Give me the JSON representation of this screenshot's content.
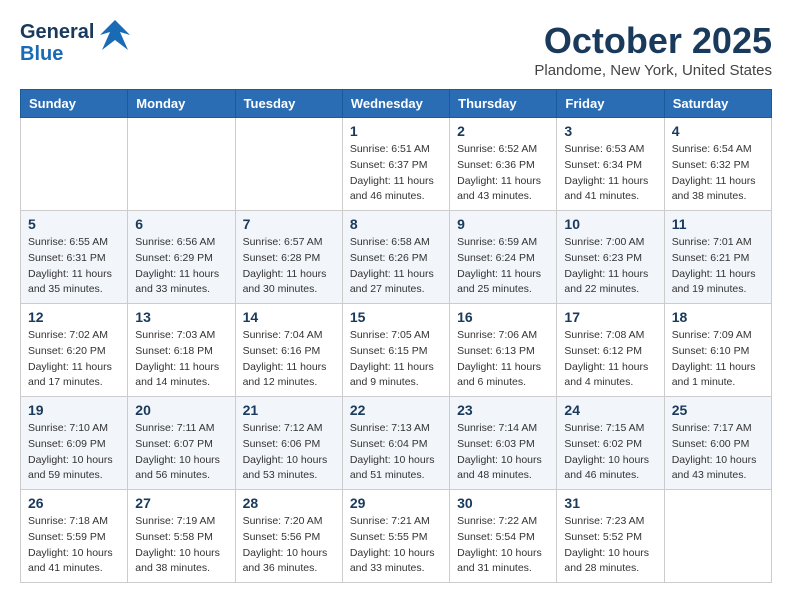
{
  "header": {
    "logo_line1": "General",
    "logo_line2": "Blue",
    "month": "October 2025",
    "location": "Plandome, New York, United States"
  },
  "days_of_week": [
    "Sunday",
    "Monday",
    "Tuesday",
    "Wednesday",
    "Thursday",
    "Friday",
    "Saturday"
  ],
  "weeks": [
    [
      {
        "day": "",
        "info": ""
      },
      {
        "day": "",
        "info": ""
      },
      {
        "day": "",
        "info": ""
      },
      {
        "day": "1",
        "info": "Sunrise: 6:51 AM\nSunset: 6:37 PM\nDaylight: 11 hours\nand 46 minutes."
      },
      {
        "day": "2",
        "info": "Sunrise: 6:52 AM\nSunset: 6:36 PM\nDaylight: 11 hours\nand 43 minutes."
      },
      {
        "day": "3",
        "info": "Sunrise: 6:53 AM\nSunset: 6:34 PM\nDaylight: 11 hours\nand 41 minutes."
      },
      {
        "day": "4",
        "info": "Sunrise: 6:54 AM\nSunset: 6:32 PM\nDaylight: 11 hours\nand 38 minutes."
      }
    ],
    [
      {
        "day": "5",
        "info": "Sunrise: 6:55 AM\nSunset: 6:31 PM\nDaylight: 11 hours\nand 35 minutes."
      },
      {
        "day": "6",
        "info": "Sunrise: 6:56 AM\nSunset: 6:29 PM\nDaylight: 11 hours\nand 33 minutes."
      },
      {
        "day": "7",
        "info": "Sunrise: 6:57 AM\nSunset: 6:28 PM\nDaylight: 11 hours\nand 30 minutes."
      },
      {
        "day": "8",
        "info": "Sunrise: 6:58 AM\nSunset: 6:26 PM\nDaylight: 11 hours\nand 27 minutes."
      },
      {
        "day": "9",
        "info": "Sunrise: 6:59 AM\nSunset: 6:24 PM\nDaylight: 11 hours\nand 25 minutes."
      },
      {
        "day": "10",
        "info": "Sunrise: 7:00 AM\nSunset: 6:23 PM\nDaylight: 11 hours\nand 22 minutes."
      },
      {
        "day": "11",
        "info": "Sunrise: 7:01 AM\nSunset: 6:21 PM\nDaylight: 11 hours\nand 19 minutes."
      }
    ],
    [
      {
        "day": "12",
        "info": "Sunrise: 7:02 AM\nSunset: 6:20 PM\nDaylight: 11 hours\nand 17 minutes."
      },
      {
        "day": "13",
        "info": "Sunrise: 7:03 AM\nSunset: 6:18 PM\nDaylight: 11 hours\nand 14 minutes."
      },
      {
        "day": "14",
        "info": "Sunrise: 7:04 AM\nSunset: 6:16 PM\nDaylight: 11 hours\nand 12 minutes."
      },
      {
        "day": "15",
        "info": "Sunrise: 7:05 AM\nSunset: 6:15 PM\nDaylight: 11 hours\nand 9 minutes."
      },
      {
        "day": "16",
        "info": "Sunrise: 7:06 AM\nSunset: 6:13 PM\nDaylight: 11 hours\nand 6 minutes."
      },
      {
        "day": "17",
        "info": "Sunrise: 7:08 AM\nSunset: 6:12 PM\nDaylight: 11 hours\nand 4 minutes."
      },
      {
        "day": "18",
        "info": "Sunrise: 7:09 AM\nSunset: 6:10 PM\nDaylight: 11 hours\nand 1 minute."
      }
    ],
    [
      {
        "day": "19",
        "info": "Sunrise: 7:10 AM\nSunset: 6:09 PM\nDaylight: 10 hours\nand 59 minutes."
      },
      {
        "day": "20",
        "info": "Sunrise: 7:11 AM\nSunset: 6:07 PM\nDaylight: 10 hours\nand 56 minutes."
      },
      {
        "day": "21",
        "info": "Sunrise: 7:12 AM\nSunset: 6:06 PM\nDaylight: 10 hours\nand 53 minutes."
      },
      {
        "day": "22",
        "info": "Sunrise: 7:13 AM\nSunset: 6:04 PM\nDaylight: 10 hours\nand 51 minutes."
      },
      {
        "day": "23",
        "info": "Sunrise: 7:14 AM\nSunset: 6:03 PM\nDaylight: 10 hours\nand 48 minutes."
      },
      {
        "day": "24",
        "info": "Sunrise: 7:15 AM\nSunset: 6:02 PM\nDaylight: 10 hours\nand 46 minutes."
      },
      {
        "day": "25",
        "info": "Sunrise: 7:17 AM\nSunset: 6:00 PM\nDaylight: 10 hours\nand 43 minutes."
      }
    ],
    [
      {
        "day": "26",
        "info": "Sunrise: 7:18 AM\nSunset: 5:59 PM\nDaylight: 10 hours\nand 41 minutes."
      },
      {
        "day": "27",
        "info": "Sunrise: 7:19 AM\nSunset: 5:58 PM\nDaylight: 10 hours\nand 38 minutes."
      },
      {
        "day": "28",
        "info": "Sunrise: 7:20 AM\nSunset: 5:56 PM\nDaylight: 10 hours\nand 36 minutes."
      },
      {
        "day": "29",
        "info": "Sunrise: 7:21 AM\nSunset: 5:55 PM\nDaylight: 10 hours\nand 33 minutes."
      },
      {
        "day": "30",
        "info": "Sunrise: 7:22 AM\nSunset: 5:54 PM\nDaylight: 10 hours\nand 31 minutes."
      },
      {
        "day": "31",
        "info": "Sunrise: 7:23 AM\nSunset: 5:52 PM\nDaylight: 10 hours\nand 28 minutes."
      },
      {
        "day": "",
        "info": ""
      }
    ]
  ]
}
